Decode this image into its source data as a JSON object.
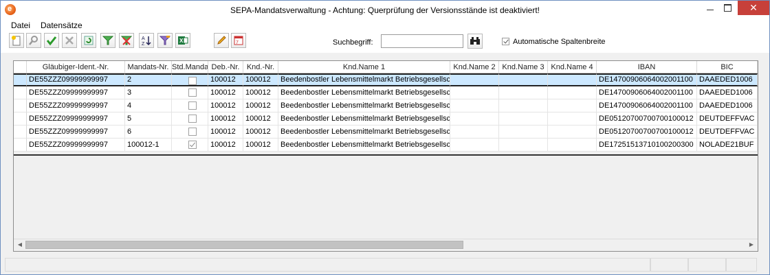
{
  "window": {
    "title": "SEPA-Mandatsverwaltung - Achtung: Querprüfung der Versionsstände ist deaktiviert!",
    "min_symbol": "",
    "max_symbol": "",
    "close_symbol": "✕",
    "app_icon_letter": "e"
  },
  "menu": [
    "Datei",
    "Datensätze"
  ],
  "toolbar": {
    "buttons": [
      {
        "name": "new-record-icon"
      },
      {
        "name": "search-magnifier-icon"
      },
      {
        "name": "confirm-check-icon"
      },
      {
        "name": "cancel-x-icon"
      },
      {
        "name": "refresh-icon"
      },
      {
        "name": "filter-icon"
      },
      {
        "name": "remove-filter-icon"
      },
      {
        "name": "sort-az-icon"
      },
      {
        "name": "filter-options-icon"
      },
      {
        "name": "excel-export-icon"
      },
      {
        "name": "edit-pencil-icon"
      },
      {
        "name": "calendar-icon"
      }
    ],
    "search_label": "Suchbegriff:",
    "search_value": "",
    "search_button_icon": "binoculars-icon",
    "auto_col_label": "Automatische Spaltenbreite",
    "auto_col_checked": true
  },
  "colors": {
    "selected_row": "#cce8ff",
    "close_button": "#c7403a"
  },
  "grid": {
    "columns": [
      "Gläubiger-Ident.-Nr.",
      "Mandats-Nr.",
      "Std.Mandat",
      "Deb.-Nr.",
      "Knd.-Nr.",
      "Knd.Name 1",
      "Knd.Name 2",
      "Knd.Name 3",
      "Knd.Name 4",
      "IBAN",
      "BIC"
    ],
    "rows": [
      {
        "glaeubiger": "DE55ZZZ09999999997",
        "mandat": "2",
        "std": false,
        "deb": "100012",
        "knd": "100012",
        "name1": "Beedenbostler Lebensmittelmarkt Betriebsgesellsch",
        "name2": "",
        "name3": "",
        "name4": "",
        "iban": "DE14700906064002001100",
        "bic": "DAAEDED1006",
        "selected": true
      },
      {
        "glaeubiger": "DE55ZZZ09999999997",
        "mandat": "3",
        "std": false,
        "deb": "100012",
        "knd": "100012",
        "name1": "Beedenbostler Lebensmittelmarkt Betriebsgesellsch",
        "name2": "",
        "name3": "",
        "name4": "",
        "iban": "DE14700906064002001100",
        "bic": "DAAEDED1006",
        "selected": false
      },
      {
        "glaeubiger": "DE55ZZZ09999999997",
        "mandat": "4",
        "std": false,
        "deb": "100012",
        "knd": "100012",
        "name1": "Beedenbostler Lebensmittelmarkt Betriebsgesellsch",
        "name2": "",
        "name3": "",
        "name4": "",
        "iban": "DE14700906064002001100",
        "bic": "DAAEDED1006",
        "selected": false
      },
      {
        "glaeubiger": "DE55ZZZ09999999997",
        "mandat": "5",
        "std": false,
        "deb": "100012",
        "knd": "100012",
        "name1": "Beedenbostler Lebensmittelmarkt Betriebsgesellsch",
        "name2": "",
        "name3": "",
        "name4": "",
        "iban": "DE05120700700700100012",
        "bic": "DEUTDEFFVAC",
        "selected": false
      },
      {
        "glaeubiger": "DE55ZZZ09999999997",
        "mandat": "6",
        "std": false,
        "deb": "100012",
        "knd": "100012",
        "name1": "Beedenbostler Lebensmittelmarkt Betriebsgesellsch",
        "name2": "",
        "name3": "",
        "name4": "",
        "iban": "DE05120700700700100012",
        "bic": "DEUTDEFFVAC",
        "selected": false
      },
      {
        "glaeubiger": "DE55ZZZ09999999997",
        "mandat": "100012-1",
        "std": true,
        "deb": "100012",
        "knd": "100012",
        "name1": "Beedenbostler Lebensmittelmarkt Betriebsgesellsch",
        "name2": "",
        "name3": "",
        "name4": "",
        "iban": "DE17251513710100200300",
        "bic": "NOLADE21BUF",
        "selected": false
      }
    ],
    "scroll_left_symbol": "◀",
    "scroll_right_symbol": "▶"
  }
}
